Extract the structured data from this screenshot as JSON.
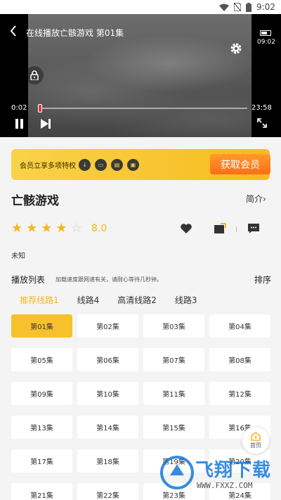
{
  "status_bar": {
    "time": "9:02"
  },
  "player": {
    "title": "在线播放亡骸游戏 第01集",
    "clock": "09:02",
    "current_time": "0:02",
    "duration": "23:58",
    "progress": 0.001
  },
  "vip": {
    "text": "会员立享多项特权",
    "button": "获取会员"
  },
  "show": {
    "title": "亡骸游戏",
    "intro_label": "简介",
    "rating": 8.0,
    "rating_text": "8.0",
    "stars_filled": 4,
    "stars_total": 5,
    "meta": "未知"
  },
  "playlist": {
    "label": "播放列表",
    "hint": "加载速度跟网速有关，请耐心等待几秒钟。",
    "sort_label": "排序",
    "routes": [
      "推荐线路1",
      "线路4",
      "高清线路2",
      "线路3"
    ],
    "active_route": 0,
    "episodes": [
      "第01集",
      "第02集",
      "第03集",
      "第04集",
      "第05集",
      "第06集",
      "第07集",
      "第08集",
      "第09集",
      "第10集",
      "第11集",
      "第12集",
      "第13集",
      "第14集",
      "第15集",
      "第16集",
      "第17集",
      "第18集",
      "第19集",
      "第20集",
      "第21集",
      "第22集",
      "第23集",
      "第24集"
    ],
    "active_episode": 0
  },
  "home_button": {
    "label": "首页"
  },
  "watermark": {
    "text": "飞翔下载",
    "url": "WWW.FXXZ.COM"
  },
  "colors": {
    "accent": "#f6b51a",
    "vip_button": "#ff7a1f",
    "progress_thumb": "#e53935"
  }
}
